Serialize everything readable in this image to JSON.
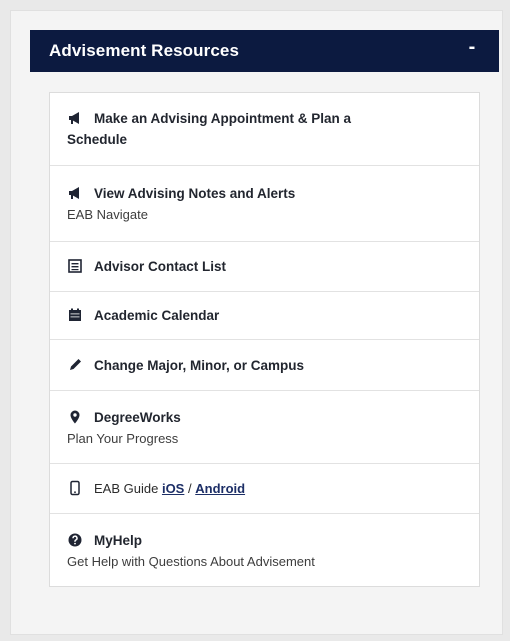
{
  "panel": {
    "title": "Advisement Resources",
    "collapse_label": "-"
  },
  "items": [
    {
      "title_a": "Make an Advising Appointment & Plan a",
      "title_b": "Schedule",
      "icon": "bullhorn-icon"
    },
    {
      "title": "View Advising Notes and Alerts",
      "subtitle": "EAB Navigate",
      "icon": "bullhorn-icon"
    },
    {
      "title": "Advisor Contact List",
      "icon": "contact-list-icon"
    },
    {
      "title": "Academic Calendar",
      "icon": "calendar-icon"
    },
    {
      "title": "Change Major, Minor, or Campus",
      "icon": "pencil-icon"
    },
    {
      "title": "DegreeWorks",
      "subtitle": "Plan Your Progress",
      "icon": "map-marker-icon"
    },
    {
      "prefix": "EAB Guide",
      "link_ios": "iOS",
      "separator": "/",
      "link_android": "Android",
      "icon": "mobile-phone-icon"
    },
    {
      "title": "MyHelp",
      "subtitle": "Get Help with Questions About Advisement",
      "icon": "question-circle-icon"
    }
  ],
  "colors": {
    "header_bg": "#0c1a40",
    "page_bg": "#e9e9e9"
  }
}
